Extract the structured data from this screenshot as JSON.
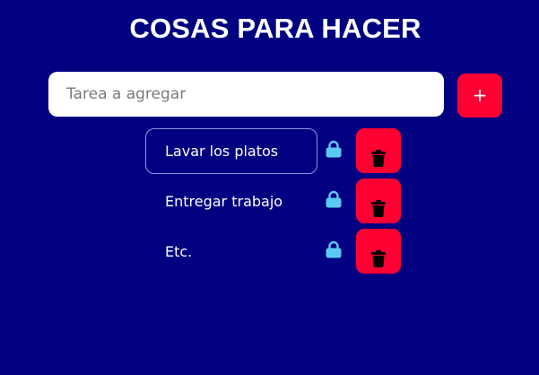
{
  "header": {
    "title": "COSAS PARA HACER"
  },
  "new_task": {
    "placeholder": "Tarea a agregar",
    "value": "",
    "add_label": "+"
  },
  "tasks": [
    {
      "label": "Lavar los platos",
      "selected": true,
      "lock_icon": "lock-icon",
      "delete_icon": "trash-icon"
    },
    {
      "label": "Entregar trabajo",
      "selected": false,
      "lock_icon": "lock-icon",
      "delete_icon": "trash-icon"
    },
    {
      "label": "Etc.",
      "selected": false,
      "lock_icon": "lock-icon",
      "delete_icon": "trash-icon"
    }
  ],
  "colors": {
    "background": "#000080",
    "accent_button": "#ff0033",
    "lock_icon": "#5cc8f5",
    "text": "#ffffff"
  }
}
